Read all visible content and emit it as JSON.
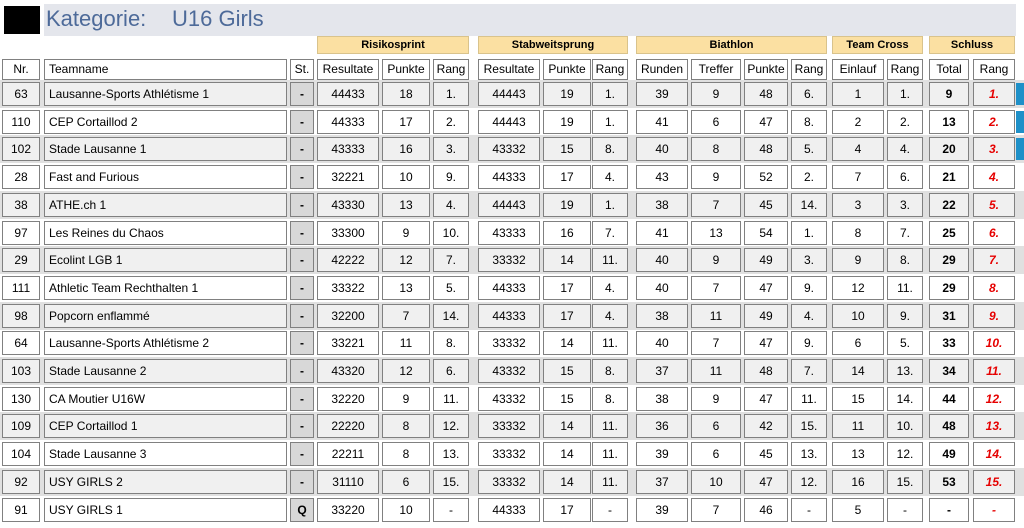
{
  "category": {
    "label": "Kategorie:",
    "value": "U16 Girls"
  },
  "groups": [
    "Risikosprint",
    "Stabweitsprung",
    "Biathlon",
    "Team Cross",
    "Schluss"
  ],
  "headers": [
    "Nr.",
    "Teamname",
    "St.",
    "Resultate",
    "Punkte",
    "Rang",
    "Resultate",
    "Punkte",
    "Rang",
    "Runden",
    "Treffer",
    "Punkte",
    "Rang",
    "Einlauf",
    "Rang",
    "Total",
    "Rang"
  ],
  "rows": [
    [
      "63",
      "Lausanne-Sports Athlétisme 1",
      "-",
      "44433",
      "18",
      "1.",
      "44443",
      "19",
      "1.",
      "39",
      "9",
      "48",
      "6.",
      "1",
      "1.",
      "9",
      "1."
    ],
    [
      "110",
      "CEP Cortaillod 2",
      "-",
      "44333",
      "17",
      "2.",
      "44443",
      "19",
      "1.",
      "41",
      "6",
      "47",
      "8.",
      "2",
      "2.",
      "13",
      "2."
    ],
    [
      "102",
      "Stade Lausanne 1",
      "-",
      "43333",
      "16",
      "3.",
      "43332",
      "15",
      "8.",
      "40",
      "8",
      "48",
      "5.",
      "4",
      "4.",
      "20",
      "3."
    ],
    [
      "28",
      "Fast and Furious",
      "-",
      "32221",
      "10",
      "9.",
      "44333",
      "17",
      "4.",
      "43",
      "9",
      "52",
      "2.",
      "7",
      "6.",
      "21",
      "4."
    ],
    [
      "38",
      "ATHE.ch 1",
      "-",
      "43330",
      "13",
      "4.",
      "44443",
      "19",
      "1.",
      "38",
      "7",
      "45",
      "14.",
      "3",
      "3.",
      "22",
      "5."
    ],
    [
      "97",
      "Les Reines du Chaos",
      "-",
      "33300",
      "9",
      "10.",
      "43333",
      "16",
      "7.",
      "41",
      "13",
      "54",
      "1.",
      "8",
      "7.",
      "25",
      "6."
    ],
    [
      "29",
      "Ecolint LGB 1",
      "-",
      "42222",
      "12",
      "7.",
      "33332",
      "14",
      "11.",
      "40",
      "9",
      "49",
      "3.",
      "9",
      "8.",
      "29",
      "7."
    ],
    [
      "111",
      "Athletic Team Rechthalten 1",
      "-",
      "33322",
      "13",
      "5.",
      "44333",
      "17",
      "4.",
      "40",
      "7",
      "47",
      "9.",
      "12",
      "11.",
      "29",
      "8."
    ],
    [
      "98",
      "Popcorn enflammé",
      "-",
      "32200",
      "7",
      "14.",
      "44333",
      "17",
      "4.",
      "38",
      "11",
      "49",
      "4.",
      "10",
      "9.",
      "31",
      "9."
    ],
    [
      "64",
      "Lausanne-Sports Athlétisme 2",
      "-",
      "33221",
      "11",
      "8.",
      "33332",
      "14",
      "11.",
      "40",
      "7",
      "47",
      "9.",
      "6",
      "5.",
      "33",
      "10."
    ],
    [
      "103",
      "Stade Lausanne 2",
      "-",
      "43320",
      "12",
      "6.",
      "43332",
      "15",
      "8.",
      "37",
      "11",
      "48",
      "7.",
      "14",
      "13.",
      "34",
      "11."
    ],
    [
      "130",
      "CA Moutier U16W",
      "-",
      "32220",
      "9",
      "11.",
      "43332",
      "15",
      "8.",
      "38",
      "9",
      "47",
      "11.",
      "15",
      "14.",
      "44",
      "12."
    ],
    [
      "109",
      "CEP Cortaillod 1",
      "-",
      "22220",
      "8",
      "12.",
      "33332",
      "14",
      "11.",
      "36",
      "6",
      "42",
      "15.",
      "11",
      "10.",
      "48",
      "13."
    ],
    [
      "104",
      "Stade Lausanne 3",
      "-",
      "22211",
      "8",
      "13.",
      "33332",
      "14",
      "11.",
      "39",
      "6",
      "45",
      "13.",
      "13",
      "12.",
      "49",
      "14."
    ],
    [
      "92",
      "USY GIRLS 2",
      "-",
      "31110",
      "6",
      "15.",
      "33332",
      "14",
      "11.",
      "37",
      "10",
      "47",
      "12.",
      "16",
      "15.",
      "53",
      "15."
    ],
    [
      "91",
      "USY GIRLS 1",
      "Q",
      "33220",
      "10",
      "-",
      "44333",
      "17",
      "-",
      "39",
      "7",
      "46",
      "-",
      "5",
      "-",
      "-",
      "-"
    ]
  ]
}
